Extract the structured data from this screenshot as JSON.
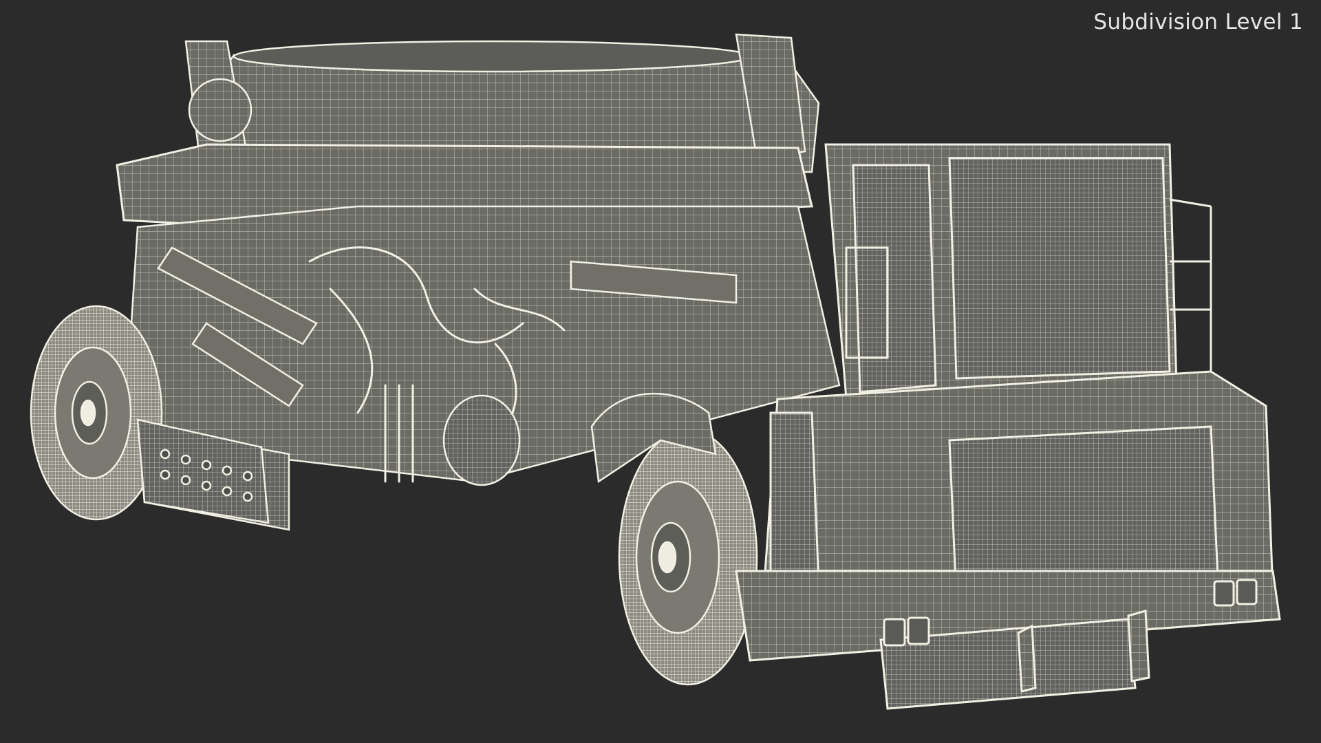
{
  "overlay": {
    "subdivision_label": "Subdivision Level 1"
  },
  "scene": {
    "background_color": "#2b2b2b",
    "wire_color": "#f2f0e4",
    "body_color": "#6e6e68"
  }
}
